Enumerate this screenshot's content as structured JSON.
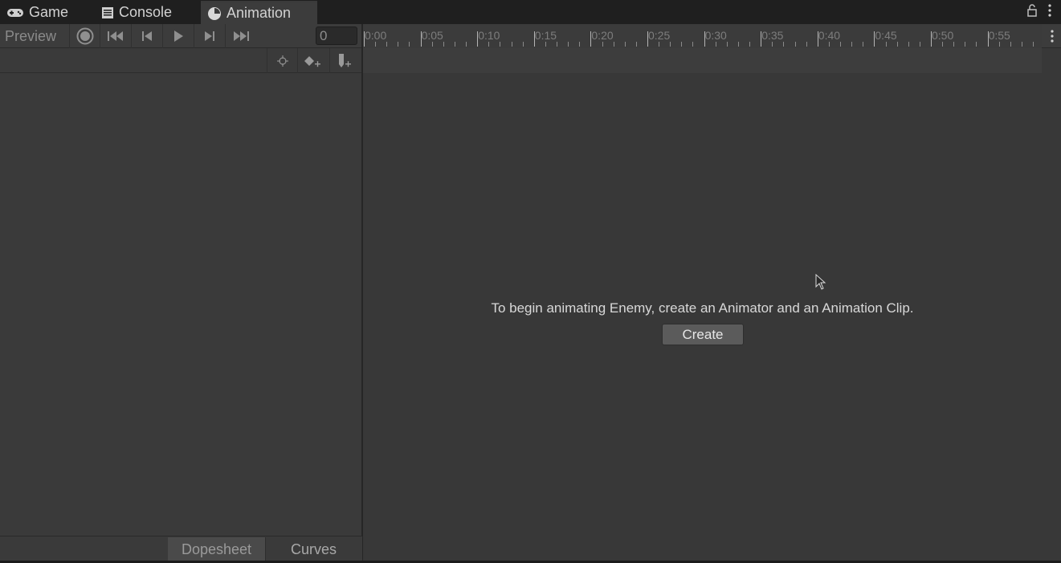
{
  "tabs": [
    {
      "label": "Game",
      "icon": "gamepad-icon"
    },
    {
      "label": "Console",
      "icon": "console-icon"
    },
    {
      "label": "Animation",
      "icon": "animation-clock-icon",
      "active": true
    }
  ],
  "toolbar": {
    "preview_label": "Preview",
    "frame_value": "0",
    "buttons": [
      "record-icon",
      "first-key-icon",
      "prev-key-icon",
      "play-icon",
      "next-key-icon",
      "last-key-icon"
    ]
  },
  "ruler": {
    "labels": [
      "0:00",
      "0:05",
      "0:10",
      "0:15",
      "0:20",
      "0:25",
      "0:30",
      "0:35",
      "0:40",
      "0:45",
      "0:50",
      "0:55"
    ]
  },
  "main": {
    "message": "To begin animating Enemy, create an Animator and an Animation Clip.",
    "create_label": "Create"
  },
  "bottom_tabs": {
    "dopesheet": "Dopesheet",
    "curves": "Curves"
  },
  "colors": {
    "background": "#383838",
    "tabbar": "#1f1f1f",
    "button": "#5b5b5b"
  }
}
